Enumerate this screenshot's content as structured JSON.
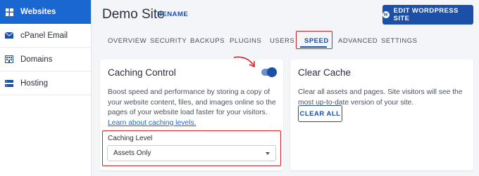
{
  "sidebar": {
    "items": [
      {
        "label": "Websites",
        "icon": "grid-icon"
      },
      {
        "label": "cPanel Email",
        "icon": "envelope-icon"
      },
      {
        "label": "Domains",
        "icon": "building-icon"
      },
      {
        "label": "Hosting",
        "icon": "server-icon"
      }
    ],
    "active_index": 0
  },
  "header": {
    "title": "Demo Site",
    "rename_label": "RENAME",
    "edit_button_label": "EDIT WORDPRESS SITE",
    "edit_button_icon": "wordpress-icon"
  },
  "tabs": [
    {
      "label": "OVERVIEW"
    },
    {
      "label": "SECURITY"
    },
    {
      "label": "BACKUPS"
    },
    {
      "label": "PLUGINS"
    },
    {
      "label": "USERS"
    },
    {
      "label": "SPEED"
    },
    {
      "label": "ADVANCED"
    },
    {
      "label": "SETTINGS"
    }
  ],
  "active_tab": "SPEED",
  "caching_control": {
    "title": "Caching Control",
    "toggle_on": true,
    "description": "Boost speed and performance by storing a copy of your website content, files, and images online so the pages of your website load faster for your visitors.",
    "link_text": "Learn about caching levels.",
    "level_label": "Caching Level",
    "level_value": "Assets Only"
  },
  "clear_cache": {
    "title": "Clear Cache",
    "description": "Clear all assets and pages. Site visitors will see the most up-to-date version of your site.",
    "button_label": "CLEAR ALL"
  },
  "colors": {
    "primary": "#1b4fa8",
    "sidebar_active": "#1b67d2",
    "highlight": "#d0242a",
    "background": "#f4f5f8"
  }
}
